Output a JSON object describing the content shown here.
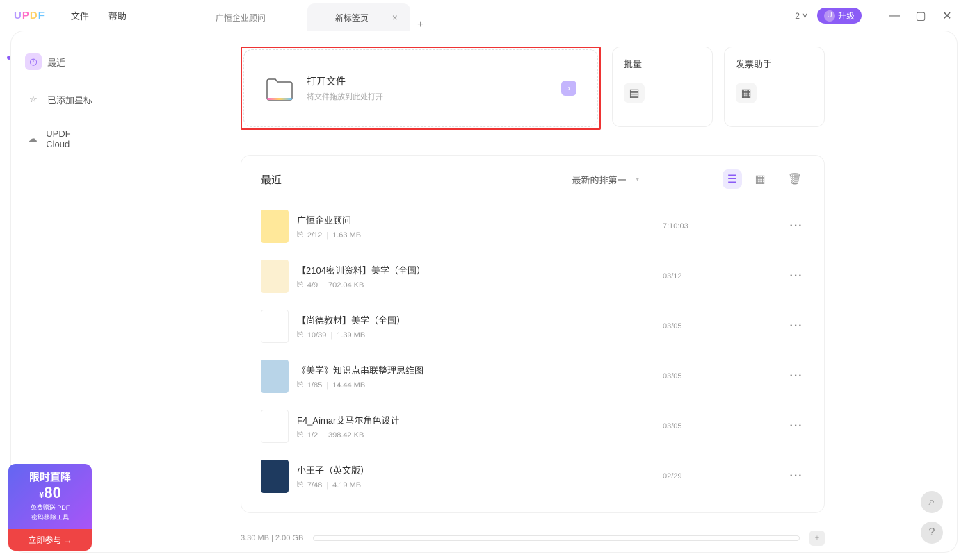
{
  "logo": {
    "u": "U",
    "p": "P",
    "d": "D",
    "f": "F"
  },
  "menu": {
    "file": "文件",
    "help": "帮助"
  },
  "tabs": {
    "inactive": "广恒企业顾问",
    "active": "新标签页",
    "new_tab_icon": "+",
    "close_icon": "×"
  },
  "titlebar": {
    "count": "2",
    "upgrade_avatar": "U",
    "upgrade_label": "升级"
  },
  "sidebar": {
    "recent": "最近",
    "starred": "已添加星标",
    "cloud": "UPDF Cloud"
  },
  "open_card": {
    "title": "打开文件",
    "sub": "将文件拖放到此处打开"
  },
  "side_cards": {
    "batch": "批量",
    "invoice": "发票助手"
  },
  "recent": {
    "title": "最近",
    "sort": "最新的排第一",
    "files": [
      {
        "name": "广恒企业顾问",
        "pages": "2/12",
        "size": "1.63 MB",
        "date": "7:10:03"
      },
      {
        "name": "【2104密训资料】美学（全国）",
        "pages": "4/9",
        "size": "702.04 KB",
        "date": "03/12"
      },
      {
        "name": "【尚德教材】美学（全国）",
        "pages": "10/39",
        "size": "1.39 MB",
        "date": "03/05"
      },
      {
        "name": "《美学》知识点串联整理思维图",
        "pages": "1/85",
        "size": "14.44 MB",
        "date": "03/05"
      },
      {
        "name": "F4_Aimar艾马尔角色设计",
        "pages": "1/2",
        "size": "398.42 KB",
        "date": "03/05"
      },
      {
        "name": "小王子（英文版）",
        "pages": "7/48",
        "size": "4.19 MB",
        "date": "02/29"
      }
    ]
  },
  "storage": "3.30 MB | 2.00 GB",
  "promo": {
    "headline": "限时直降",
    "price": "80",
    "currency": "¥",
    "sub1": "免费赠送 PDF",
    "sub2": "密码移除工具",
    "cta": "立即参与 →"
  },
  "icons": {
    "more": "···",
    "search": "⌕",
    "help": "?",
    "add": "+",
    "pages": "⎘",
    "chevron": "›",
    "caret": "▾",
    "chevron_down": "˅"
  }
}
